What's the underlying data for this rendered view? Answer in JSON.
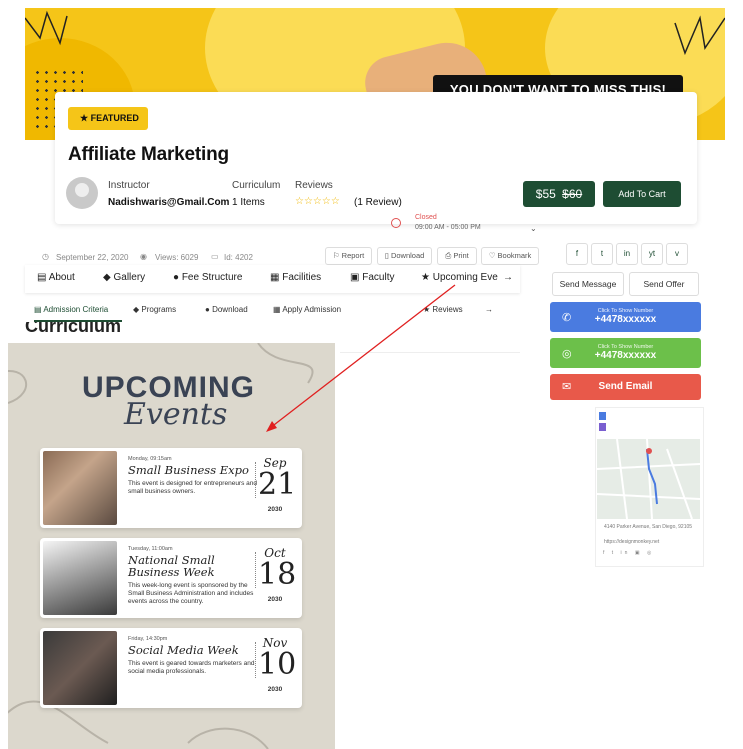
{
  "hero": {
    "banner_text": "YOU DON'T WANT TO MISS THIS!"
  },
  "course": {
    "badge": "FEATURED",
    "title": "Affiliate Marketing",
    "instructor_label": "Instructor",
    "instructor_name": "Nadishwaris@Gmail.Com",
    "curriculum_label": "Curriculum",
    "curriculum_value": "1 Items",
    "reviews_label": "Reviews",
    "reviews_value": "(1 Review)",
    "price": "$55",
    "old_price": "$60",
    "add_to_cart": "Add To Cart",
    "status": "Closed",
    "hours": "09:00 AM - 05:00 PM"
  },
  "meta": {
    "date": "September 22, 2020",
    "views": "Views: 6029",
    "id": "Id: 4202",
    "report": "Report",
    "download": "Download",
    "print": "Print",
    "bookmark": "Bookmark"
  },
  "tabs": [
    "About",
    "Gallery",
    "Fee Structure",
    "Facilities",
    "Faculty",
    "Upcoming Eve"
  ],
  "subtabs": [
    "Admission Criteria",
    "Programs",
    "Download",
    "Apply Admission",
    "Reviews"
  ],
  "section_heading": "Curriculum",
  "sidebar": {
    "social": [
      "f",
      "t",
      "in",
      "yt",
      "v"
    ],
    "send_message": "Send Message",
    "send_offer": "Send Offer",
    "call_hint": "Click To Show Number",
    "phone": "+4478xxxxxx",
    "whatsapp_hint": "Click To Show Number",
    "whatsapp_phone": "+4478xxxxxx",
    "send_email": "Send Email",
    "address": "4140 Parker Avenue, San Diego, 92105",
    "website": "https://designmonkey.net"
  },
  "poster": {
    "title_top": "UPCOMING",
    "title_bottom": "Events",
    "events": [
      {
        "day": "Monday, 09:15am",
        "name": "Small Business Expo",
        "desc": "This event is designed for entrepreneurs and small business owners.",
        "month": "Sep",
        "date": "21",
        "year": "2030"
      },
      {
        "day": "Tuesday, 11:00am",
        "name": "National Small Business Week",
        "desc": "This week-long event is sponsored by the Small Business Administration and includes events across the country.",
        "month": "Oct",
        "date": "18",
        "year": "2030"
      },
      {
        "day": "Friday, 14:30pm",
        "name": "Social Media Week",
        "desc": "This event is geared towards marketers and social media professionals.",
        "month": "Nov",
        "date": "10",
        "year": "2030"
      }
    ]
  },
  "colors": {
    "brand_green": "#1e4d33",
    "yellow": "#f5c518",
    "blue": "#4a7be0",
    "whatsapp": "#6cc04a",
    "email": "#e8594a",
    "arrow": "#e02020"
  }
}
